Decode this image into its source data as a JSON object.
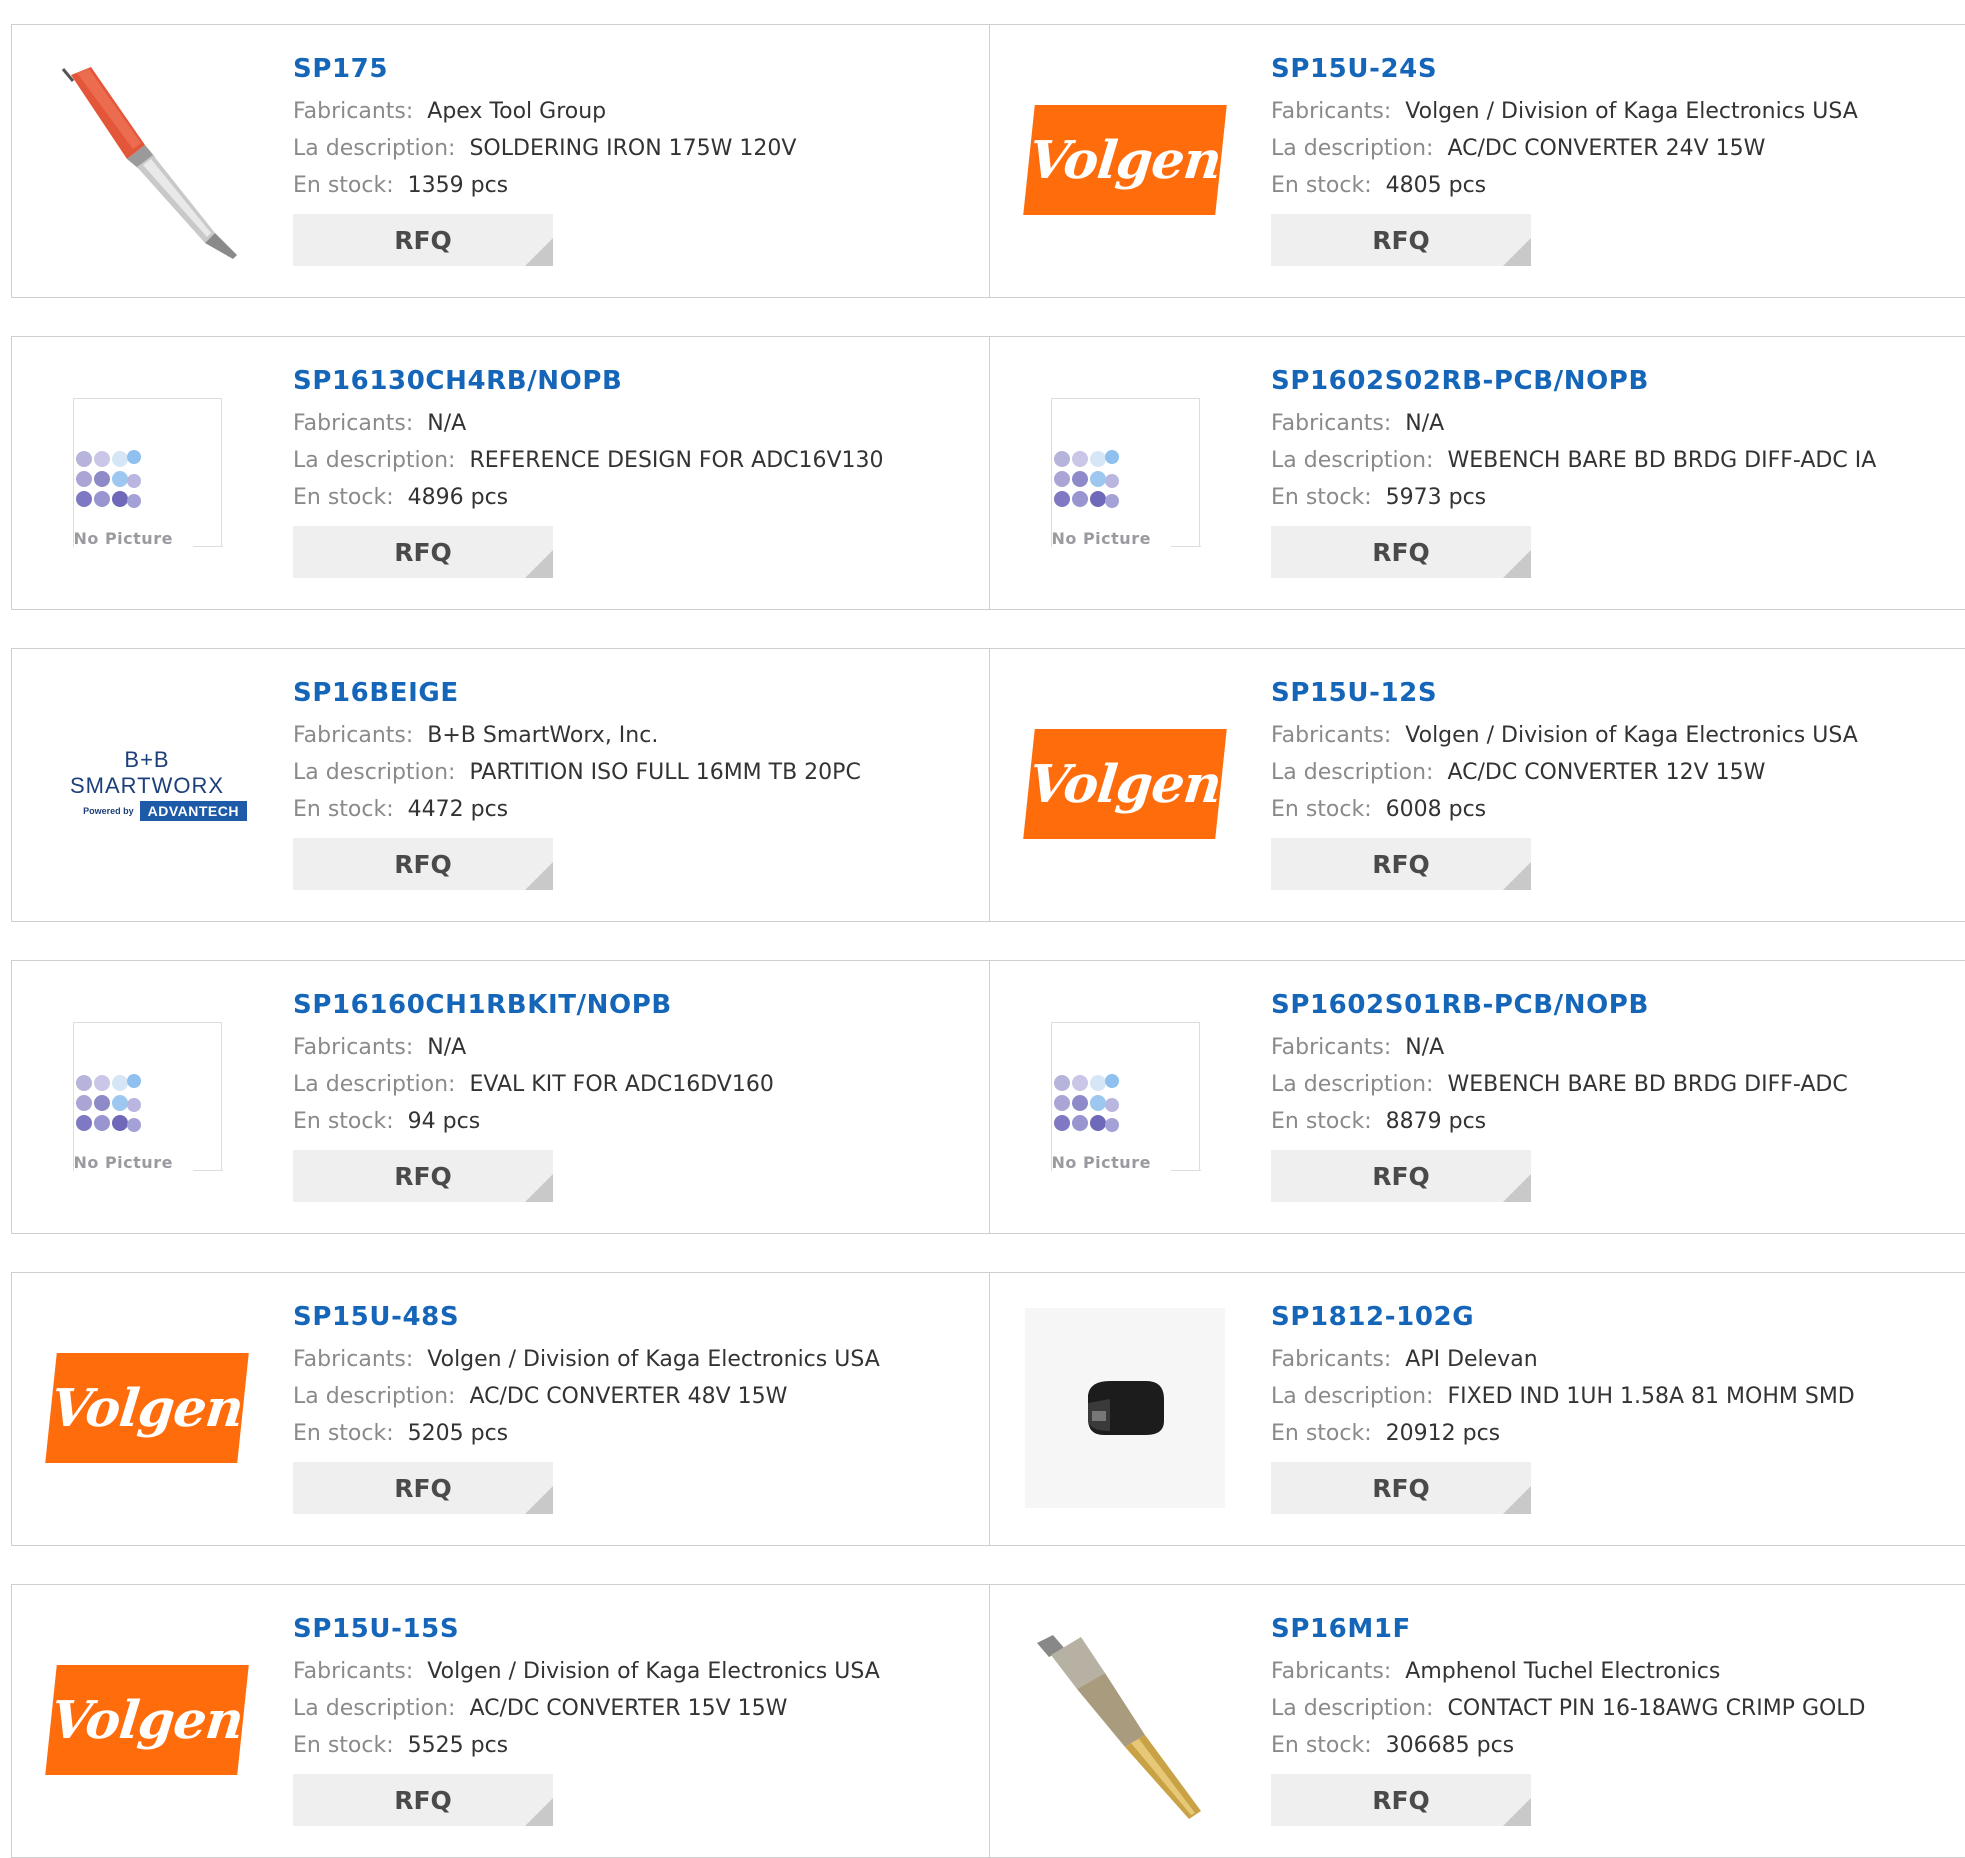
{
  "labels": {
    "manufacturer": "Fabricants:",
    "description": "La description:",
    "stock": "En stock:",
    "rfq": "RFQ"
  },
  "no_picture_text": "No Picture",
  "volgen_logo_text": "Volgen",
  "bb_logo": {
    "line1": "B+B SMARTWORX",
    "powered": "Powered by",
    "advantech": "ADVANTECH"
  },
  "colors": {
    "part_link": "#1565b8",
    "volgen_orange": "#ff6c0c",
    "label_gray": "#8a8a8a"
  },
  "products": [
    {
      "part": "SP175",
      "manufacturer": "Apex Tool Group",
      "description": "SOLDERING IRON 175W 120V",
      "stock": "1359 pcs",
      "image": "soldering-iron"
    },
    {
      "part": "SP15U-24S",
      "manufacturer": "Volgen / Division of Kaga Electronics USA",
      "description": "AC/DC CONVERTER 24V 15W",
      "stock": "4805 pcs",
      "image": "volgen-logo"
    },
    {
      "part": "SP16130CH4RB/NOPB",
      "manufacturer": "N/A",
      "description": "REFERENCE DESIGN FOR ADC16V130",
      "stock": "4896 pcs",
      "image": "no-picture"
    },
    {
      "part": "SP1602S02RB-PCB/NOPB",
      "manufacturer": "N/A",
      "description": "WEBENCH BARE BD BRDG DIFF-ADC IA",
      "stock": "5973 pcs",
      "image": "no-picture"
    },
    {
      "part": "SP16BEIGE",
      "manufacturer": "B+B SmartWorx, Inc.",
      "description": "PARTITION ISO FULL 16MM TB 20PC",
      "stock": "4472 pcs",
      "image": "bb-smartworx-logo"
    },
    {
      "part": "SP15U-12S",
      "manufacturer": "Volgen / Division of Kaga Electronics USA",
      "description": "AC/DC CONVERTER 12V 15W",
      "stock": "6008 pcs",
      "image": "volgen-logo"
    },
    {
      "part": "SP16160CH1RBKIT/NOPB",
      "manufacturer": "N/A",
      "description": "EVAL KIT FOR ADC16DV160",
      "stock": "94 pcs",
      "image": "no-picture"
    },
    {
      "part": "SP1602S01RB-PCB/NOPB",
      "manufacturer": "N/A",
      "description": "WEBENCH BARE BD BRDG DIFF-ADC",
      "stock": "8879 pcs",
      "image": "no-picture"
    },
    {
      "part": "SP15U-48S",
      "manufacturer": "Volgen / Division of Kaga Electronics USA",
      "description": "AC/DC CONVERTER 48V 15W",
      "stock": "5205 pcs",
      "image": "volgen-logo"
    },
    {
      "part": "SP1812-102G",
      "manufacturer": "API Delevan",
      "description": "FIXED IND 1UH 1.58A 81 MOHM SMD",
      "stock": "20912 pcs",
      "image": "smd-inductor"
    },
    {
      "part": "SP15U-15S",
      "manufacturer": "Volgen / Division of Kaga Electronics USA",
      "description": "AC/DC CONVERTER 15V 15W",
      "stock": "5525 pcs",
      "image": "volgen-logo"
    },
    {
      "part": "SP16M1F",
      "manufacturer": "Amphenol Tuchel Electronics",
      "description": "CONTACT PIN 16-18AWG CRIMP GOLD",
      "stock": "306685 pcs",
      "image": "contact-pin"
    }
  ]
}
